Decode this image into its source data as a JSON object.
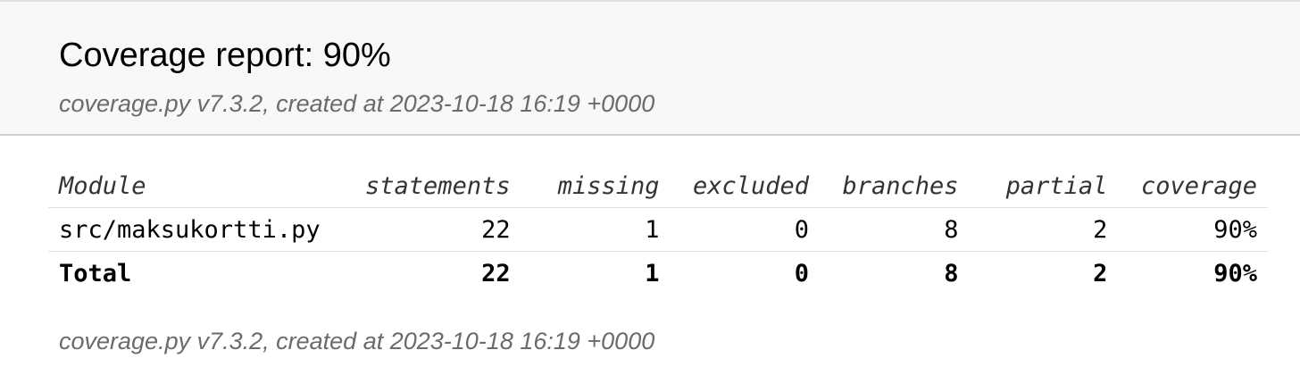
{
  "header": {
    "title": "Coverage report: 90%",
    "created": "coverage.py v7.3.2, created at 2023-10-18 16:19 +0000"
  },
  "table": {
    "columns": [
      "Module",
      "statements",
      "missing",
      "excluded",
      "branches",
      "partial",
      "coverage"
    ],
    "rows": [
      {
        "module": "src/maksukortti.py",
        "statements": "22",
        "missing": "1",
        "excluded": "0",
        "branches": "8",
        "partial": "2",
        "coverage": "90%"
      }
    ],
    "total": {
      "module": "Total",
      "statements": "22",
      "missing": "1",
      "excluded": "0",
      "branches": "8",
      "partial": "2",
      "coverage": "90%"
    }
  },
  "footer": {
    "created": "coverage.py v7.3.2, created at 2023-10-18 16:19 +0000"
  }
}
